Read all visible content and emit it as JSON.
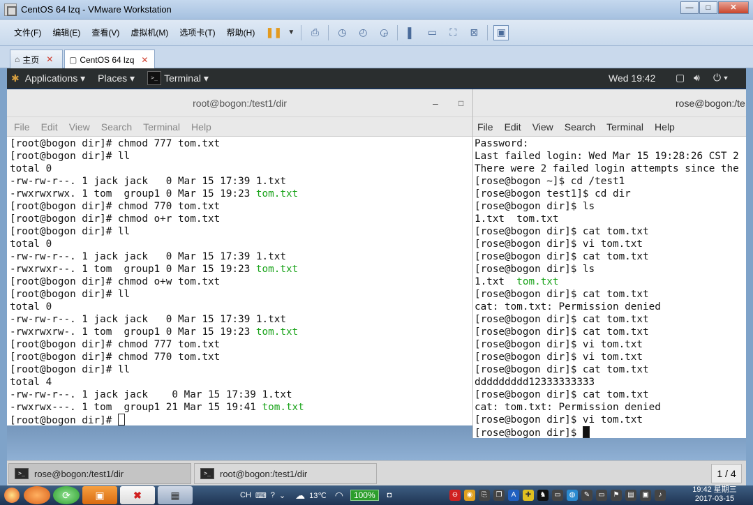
{
  "window": {
    "title": "CentOS 64 lzq - VMware Workstation",
    "min": "—",
    "max": "□",
    "close": "✕"
  },
  "menu": [
    "文件(F)",
    "编辑(E)",
    "查看(V)",
    "虚拟机(M)",
    "选项卡(T)",
    "帮助(H)"
  ],
  "tabs": [
    {
      "label": "主页",
      "close": "✕"
    },
    {
      "label": "CentOS 64 lzq",
      "close": "✕"
    }
  ],
  "gnome": {
    "applications": "Applications ▾",
    "places": "Places ▾",
    "terminal": "Terminal ▾",
    "clock": "Wed 19:42",
    "power": "⏻ ▾"
  },
  "term1": {
    "title": "root@bogon:/test1/dir",
    "minimize": "–",
    "maximize": "□",
    "menu": [
      "File",
      "Edit",
      "View",
      "Search",
      "Terminal",
      "Help"
    ],
    "lines": [
      {
        "t": "[root@bogon dir]# chmod 777 tom.txt"
      },
      {
        "t": "[root@bogon dir]# ll"
      },
      {
        "t": "total 0"
      },
      {
        "t": "-rw-rw-r--. 1 jack jack   0 Mar 15 17:39 1.txt"
      },
      {
        "t": "-rwxrwxrwx. 1 tom  group1 0 Mar 15 19:23 ",
        "g": "tom.txt"
      },
      {
        "t": "[root@bogon dir]# chmod 770 tom.txt"
      },
      {
        "t": "[root@bogon dir]# chmod o+r tom.txt"
      },
      {
        "t": "[root@bogon dir]# ll"
      },
      {
        "t": "total 0"
      },
      {
        "t": "-rw-rw-r--. 1 jack jack   0 Mar 15 17:39 1.txt"
      },
      {
        "t": "-rwxrwxr--. 1 tom  group1 0 Mar 15 19:23 ",
        "g": "tom.txt"
      },
      {
        "t": "[root@bogon dir]# chmod o+w tom.txt"
      },
      {
        "t": "[root@bogon dir]# ll"
      },
      {
        "t": "total 0"
      },
      {
        "t": "-rw-rw-r--. 1 jack jack   0 Mar 15 17:39 1.txt"
      },
      {
        "t": "-rwxrwxrw-. 1 tom  group1 0 Mar 15 19:23 ",
        "g": "tom.txt"
      },
      {
        "t": "[root@bogon dir]# chmod 777 tom.txt"
      },
      {
        "t": "[root@bogon dir]# chmod 770 tom.txt"
      },
      {
        "t": "[root@bogon dir]# ll"
      },
      {
        "t": "total 4"
      },
      {
        "t": "-rw-rw-r--. 1 jack jack    0 Mar 15 17:39 1.txt"
      },
      {
        "t": "-rwxrwx---. 1 tom  group1 21 Mar 15 19:41 ",
        "g": "tom.txt"
      },
      {
        "t": "[root@bogon dir]# ",
        "cursor": "hollow"
      }
    ]
  },
  "term2": {
    "title": "rose@bogon:/te",
    "menu": [
      "File",
      "Edit",
      "View",
      "Search",
      "Terminal",
      "Help"
    ],
    "lines": [
      {
        "t": "Password:"
      },
      {
        "t": "Last failed login: Wed Mar 15 19:28:26 CST 2"
      },
      {
        "t": "There were 2 failed login attempts since the"
      },
      {
        "t": "[rose@bogon ~]$ cd /test1"
      },
      {
        "t": "[rose@bogon test1]$ cd dir"
      },
      {
        "t": "[rose@bogon dir]$ ls"
      },
      {
        "t": "1.txt  tom.txt"
      },
      {
        "t": "[rose@bogon dir]$ cat tom.txt"
      },
      {
        "t": "[rose@bogon dir]$ vi tom.txt"
      },
      {
        "t": "[rose@bogon dir]$ cat tom.txt"
      },
      {
        "t": "[rose@bogon dir]$ ls"
      },
      {
        "t": "1.txt  ",
        "g": "tom.txt"
      },
      {
        "t": "[rose@bogon dir]$ cat tom.txt"
      },
      {
        "t": "cat: tom.txt: Permission denied"
      },
      {
        "t": "[rose@bogon dir]$ cat tom.txt"
      },
      {
        "t": "[rose@bogon dir]$ cat tom.txt"
      },
      {
        "t": "[rose@bogon dir]$ vi tom.txt"
      },
      {
        "t": "[rose@bogon dir]$ vi tom.txt"
      },
      {
        "t": "[rose@bogon dir]$ cat tom.txt"
      },
      {
        "t": "ddddddddd12333333333"
      },
      {
        "t": "[rose@bogon dir]$ cat tom.txt"
      },
      {
        "t": "cat: tom.txt: Permission denied"
      },
      {
        "t": "[rose@bogon dir]$ vi tom.txt"
      },
      {
        "t": "[rose@bogon dir]$ ",
        "cursor": "solid"
      }
    ]
  },
  "windowlist": {
    "items": [
      "rose@bogon:/test1/dir",
      "root@bogon:/test1/dir"
    ],
    "pager": "1 / 4"
  },
  "taskbar": {
    "lang": "CH",
    "temp": "13℃",
    "battery": "100%",
    "time": "19:42 星期三",
    "date": "2017-03-15"
  }
}
